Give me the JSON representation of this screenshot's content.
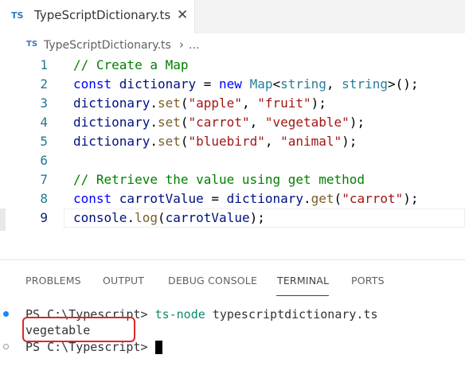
{
  "tab": {
    "badge": "TS",
    "title": "TypeScriptDictionary.ts",
    "close": "✕"
  },
  "breadcrumb": {
    "badge": "TS",
    "file": "TypeScriptDictionary.ts",
    "separator": "›",
    "more": "..."
  },
  "editor": {
    "line_numbers": [
      "1",
      "2",
      "3",
      "4",
      "5",
      "6",
      "7",
      "8",
      "9"
    ],
    "lines": [
      [
        {
          "t": "// Create a Map",
          "c": "c"
        }
      ],
      [
        {
          "t": "const ",
          "c": "k"
        },
        {
          "t": "dictionary",
          "c": "v"
        },
        {
          "t": " = ",
          "c": "p"
        },
        {
          "t": "new ",
          "c": "k"
        },
        {
          "t": "Map",
          "c": "t"
        },
        {
          "t": "<",
          "c": "p"
        },
        {
          "t": "string",
          "c": "t"
        },
        {
          "t": ", ",
          "c": "p"
        },
        {
          "t": "string",
          "c": "t"
        },
        {
          "t": ">();",
          "c": "p"
        }
      ],
      [
        {
          "t": "dictionary",
          "c": "v"
        },
        {
          "t": ".",
          "c": "p"
        },
        {
          "t": "set",
          "c": "f"
        },
        {
          "t": "(",
          "c": "p"
        },
        {
          "t": "\"apple\"",
          "c": "s"
        },
        {
          "t": ", ",
          "c": "p"
        },
        {
          "t": "\"fruit\"",
          "c": "s"
        },
        {
          "t": ");",
          "c": "p"
        }
      ],
      [
        {
          "t": "dictionary",
          "c": "v"
        },
        {
          "t": ".",
          "c": "p"
        },
        {
          "t": "set",
          "c": "f"
        },
        {
          "t": "(",
          "c": "p"
        },
        {
          "t": "\"carrot\"",
          "c": "s"
        },
        {
          "t": ", ",
          "c": "p"
        },
        {
          "t": "\"vegetable\"",
          "c": "s"
        },
        {
          "t": ");",
          "c": "p"
        }
      ],
      [
        {
          "t": "dictionary",
          "c": "v"
        },
        {
          "t": ".",
          "c": "p"
        },
        {
          "t": "set",
          "c": "f"
        },
        {
          "t": "(",
          "c": "p"
        },
        {
          "t": "\"bluebird\"",
          "c": "s"
        },
        {
          "t": ", ",
          "c": "p"
        },
        {
          "t": "\"animal\"",
          "c": "s"
        },
        {
          "t": ");",
          "c": "p"
        }
      ],
      [],
      [
        {
          "t": "// Retrieve the value using get method",
          "c": "c"
        }
      ],
      [
        {
          "t": "const ",
          "c": "k"
        },
        {
          "t": "carrotValue",
          "c": "v"
        },
        {
          "t": " = ",
          "c": "p"
        },
        {
          "t": "dictionary",
          "c": "v"
        },
        {
          "t": ".",
          "c": "p"
        },
        {
          "t": "get",
          "c": "f"
        },
        {
          "t": "(",
          "c": "p"
        },
        {
          "t": "\"carrot\"",
          "c": "s"
        },
        {
          "t": ");",
          "c": "p"
        }
      ],
      [
        {
          "t": "console",
          "c": "v"
        },
        {
          "t": ".",
          "c": "p"
        },
        {
          "t": "log",
          "c": "f"
        },
        {
          "t": "(",
          "c": "p"
        },
        {
          "t": "carrotValue",
          "c": "v"
        },
        {
          "t": ");",
          "c": "p"
        }
      ]
    ],
    "active_line": 9
  },
  "panel": {
    "tabs": [
      "PROBLEMS",
      "OUTPUT",
      "DEBUG CONSOLE",
      "TERMINAL",
      "PORTS"
    ],
    "active_tab": "TERMINAL"
  },
  "terminal": {
    "lines": [
      {
        "prompt": "PS C:\\Typescript> ",
        "command": "ts-node",
        "args": " typescriptdictionary.ts"
      },
      {
        "output": "vegetable"
      },
      {
        "prompt": "PS C:\\Typescript> "
      }
    ]
  },
  "colors": {
    "ts_blue": "#3178c6",
    "highlight_red": "#d9282c",
    "success_dot": "#1a85ff",
    "command_green": "#0e8a6e"
  }
}
